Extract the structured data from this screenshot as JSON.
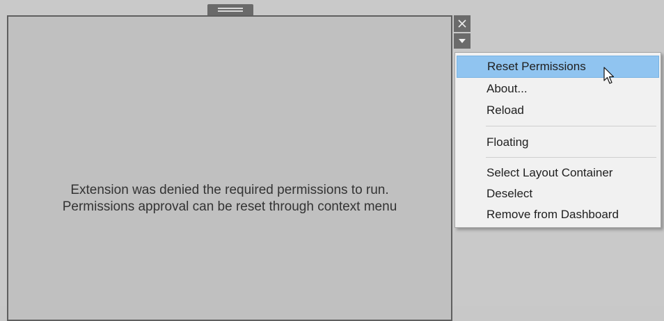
{
  "zone": {
    "message_line1": "Extension was denied the required permissions to run.",
    "message_line2": "Permissions approval can be reset through context menu"
  },
  "controls": {
    "close_icon": "close-icon",
    "dropdown_icon": "chevron-down-icon",
    "move_handle_icon": "grip-icon"
  },
  "context_menu": {
    "items": [
      {
        "label": "Reset Permissions",
        "highlighted": true
      },
      {
        "label": "About..."
      },
      {
        "label": "Reload"
      },
      {
        "label": "Floating"
      },
      {
        "label": "Select Layout Container"
      },
      {
        "label": "Deselect"
      },
      {
        "label": "Remove from Dashboard"
      }
    ]
  },
  "colors": {
    "background": "#c9c9c9",
    "zone_background": "#c0c0c0",
    "zone_border": "#5f5f5f",
    "menu_background": "#f1f1f1",
    "menu_highlight": "#90c4f0",
    "control_button": "#6b6b6b"
  }
}
